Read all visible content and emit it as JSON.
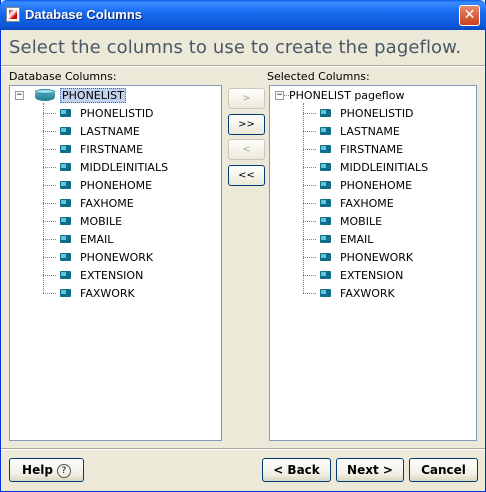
{
  "window": {
    "title": "Database Columns",
    "close_glyph": "✕"
  },
  "headline": "Select the columns to use to create the pageflow.",
  "left_panel": {
    "label": "Database Columns:",
    "root": "PHONELIST",
    "expander": "−",
    "items": [
      "PHONELISTID",
      "LASTNAME",
      "FIRSTNAME",
      "MIDDLEINITIALS",
      "PHONEHOME",
      "FAXHOME",
      "MOBILE",
      "EMAIL",
      "PHONEWORK",
      "EXTENSION",
      "FAXWORK"
    ]
  },
  "right_panel": {
    "label": "Selected Columns:",
    "root": "PHONELIST pageflow",
    "expander": "−",
    "items": [
      "PHONELISTID",
      "LASTNAME",
      "FIRSTNAME",
      "MIDDLEINITIALS",
      "PHONEHOME",
      "FAXHOME",
      "MOBILE",
      "EMAIL",
      "PHONEWORK",
      "EXTENSION",
      "FAXWORK"
    ]
  },
  "transfer_buttons": {
    "add": ">",
    "add_all": ">>",
    "remove": "<",
    "remove_all": "<<"
  },
  "footer": {
    "help": "Help",
    "help_glyph": "?",
    "back": "< Back",
    "next": "Next >",
    "cancel": "Cancel"
  }
}
